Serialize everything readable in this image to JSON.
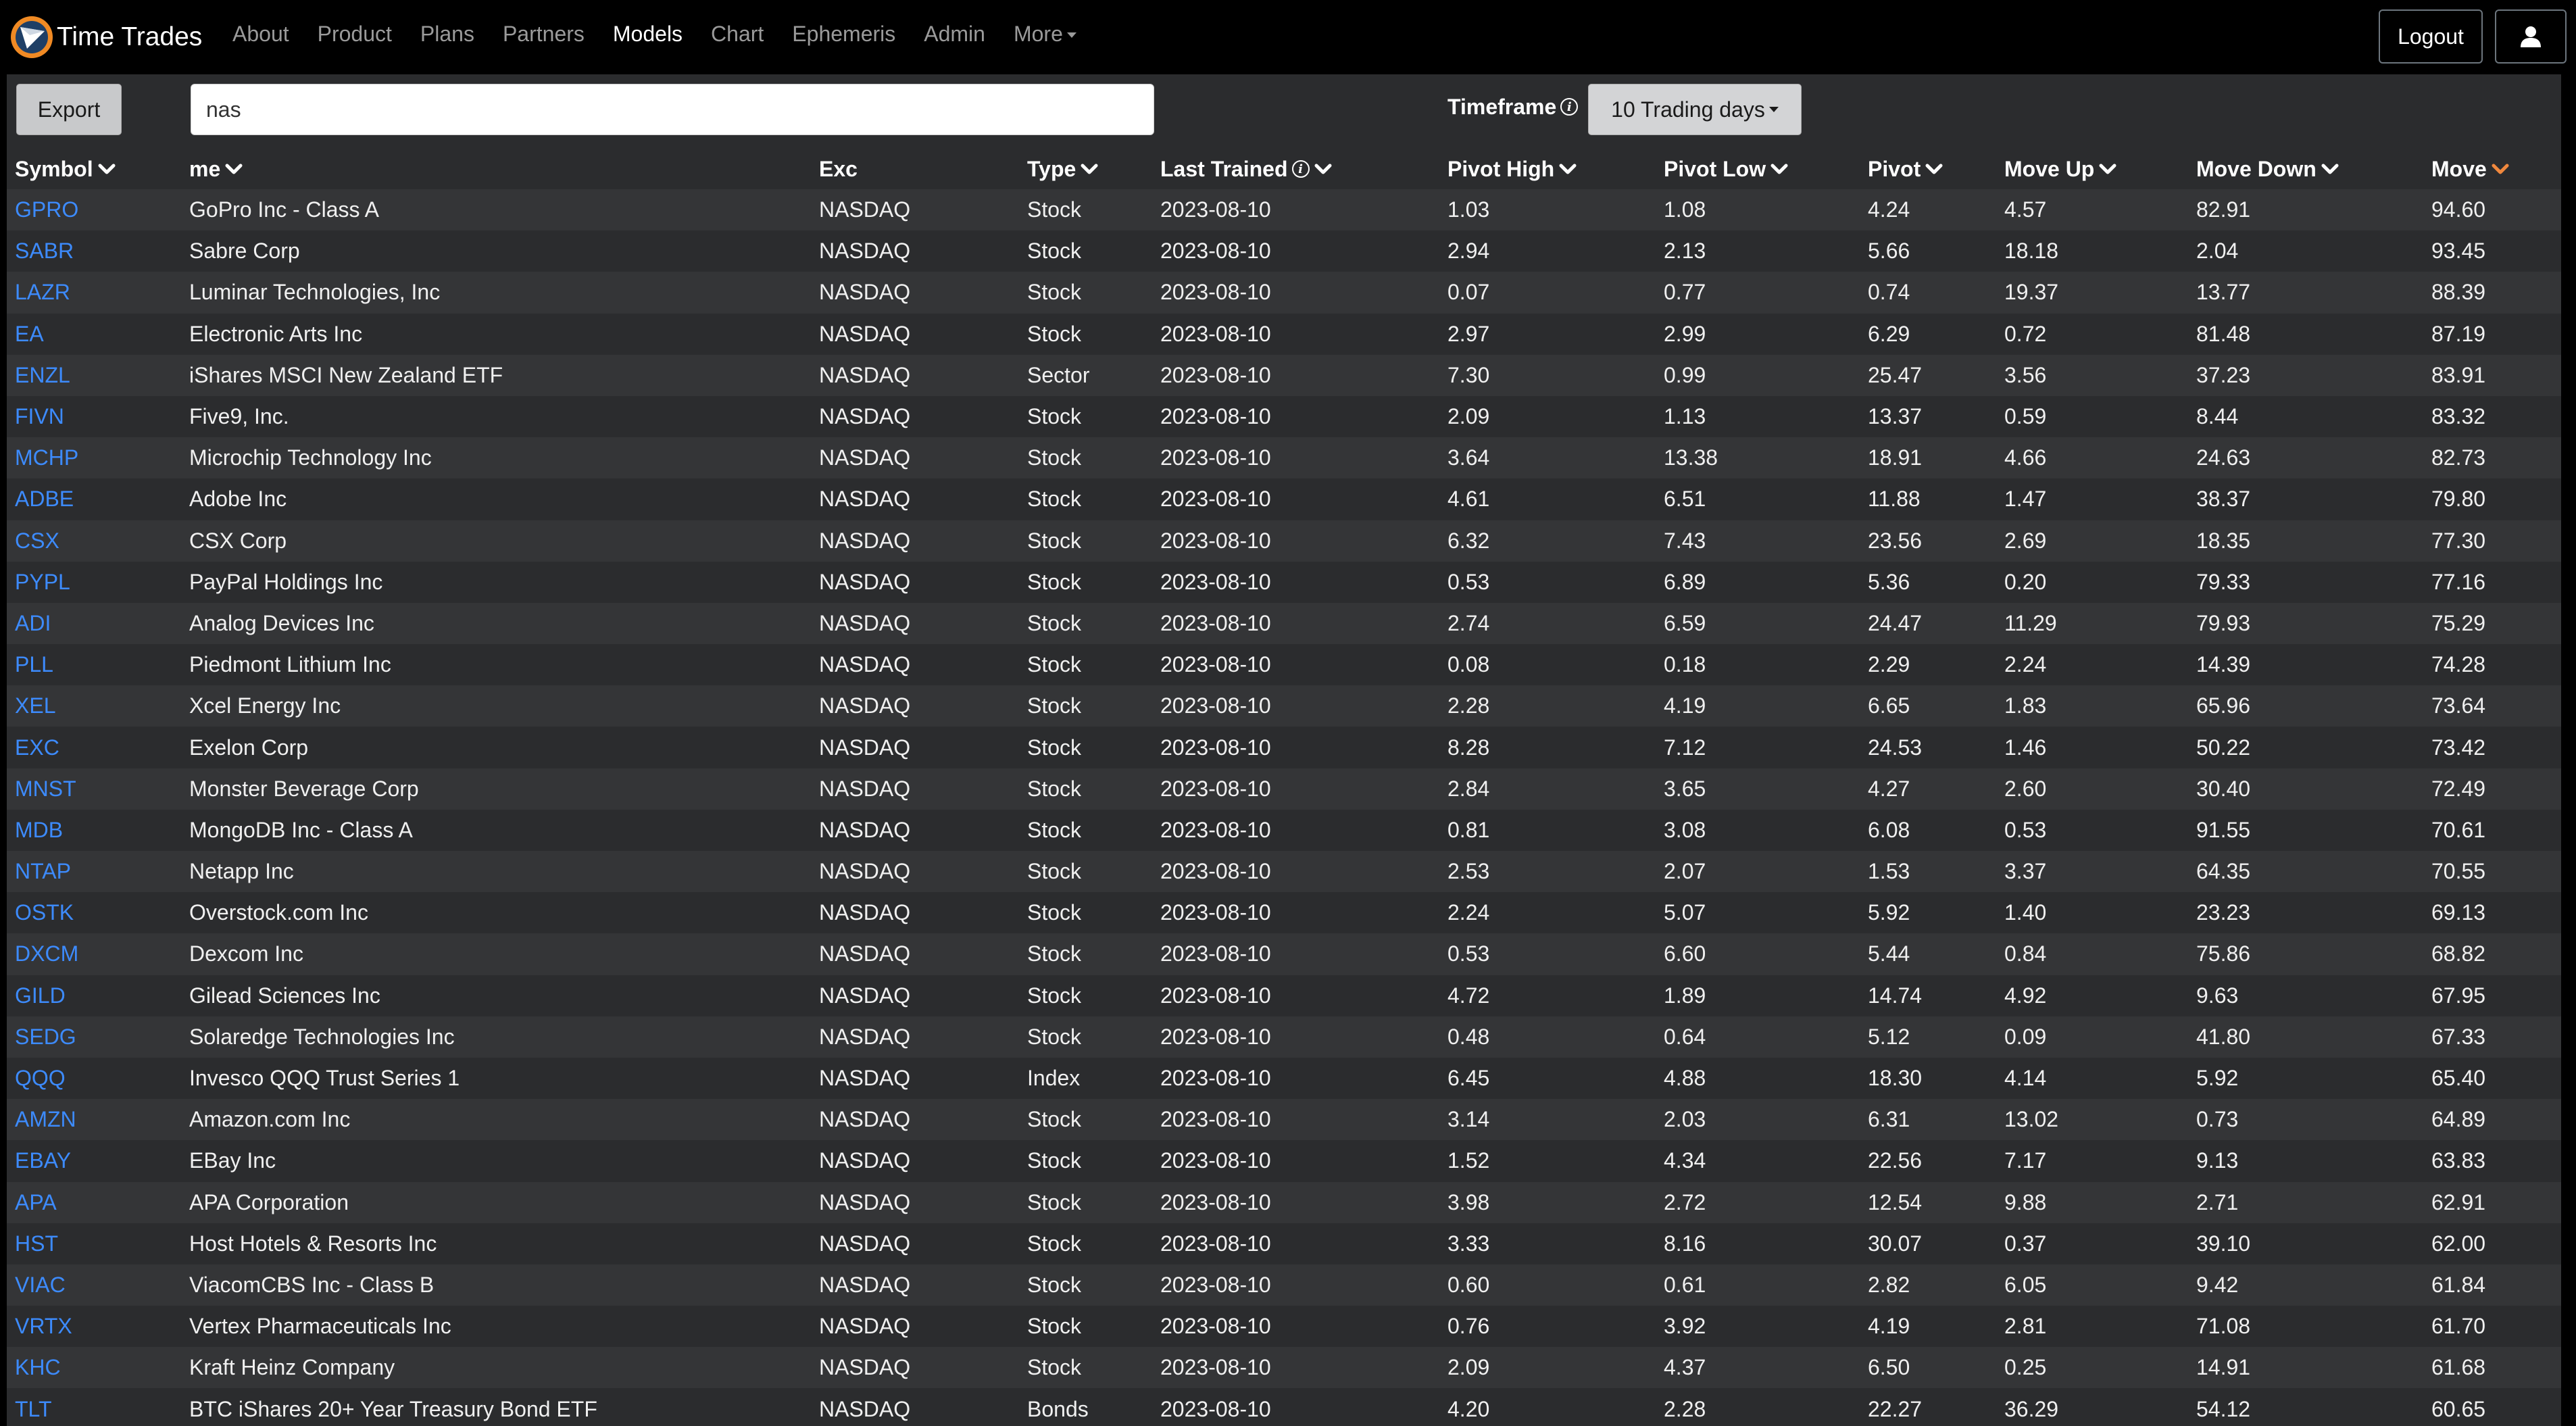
{
  "nav": {
    "brand": "Time Trades",
    "links": [
      "About",
      "Product",
      "Plans",
      "Partners",
      "Models",
      "Chart",
      "Ephemeris",
      "Admin",
      "More"
    ],
    "active": "Models",
    "logout": "Logout"
  },
  "toolbar": {
    "export_label": "Export",
    "search_value": "nas",
    "timeframe_label": "Timeframe",
    "timeframe_value": "10 Trading days"
  },
  "table": {
    "headers": [
      "Symbol",
      "me",
      "Exc",
      "Type",
      "Last Trained",
      "Pivot High",
      "Pivot Low",
      "Pivot",
      "Move Up",
      "Move Down",
      "Move"
    ],
    "sorted_header": "Move",
    "accent": "#f0883e",
    "link_color": "#3d8bfd",
    "rows": [
      [
        "GPRO",
        "GoPro Inc - Class A",
        "NASDAQ",
        "Stock",
        "2023-08-10",
        "1.03",
        "1.08",
        "4.24",
        "4.57",
        "82.91",
        "94.60"
      ],
      [
        "SABR",
        "Sabre Corp",
        "NASDAQ",
        "Stock",
        "2023-08-10",
        "2.94",
        "2.13",
        "5.66",
        "18.18",
        "2.04",
        "93.45"
      ],
      [
        "LAZR",
        "Luminar Technologies, Inc",
        "NASDAQ",
        "Stock",
        "2023-08-10",
        "0.07",
        "0.77",
        "0.74",
        "19.37",
        "13.77",
        "88.39"
      ],
      [
        "EA",
        "Electronic Arts Inc",
        "NASDAQ",
        "Stock",
        "2023-08-10",
        "2.97",
        "2.99",
        "6.29",
        "0.72",
        "81.48",
        "87.19"
      ],
      [
        "ENZL",
        "iShares MSCI New Zealand ETF",
        "NASDAQ",
        "Sector",
        "2023-08-10",
        "7.30",
        "0.99",
        "25.47",
        "3.56",
        "37.23",
        "83.91"
      ],
      [
        "FIVN",
        "Five9, Inc.",
        "NASDAQ",
        "Stock",
        "2023-08-10",
        "2.09",
        "1.13",
        "13.37",
        "0.59",
        "8.44",
        "83.32"
      ],
      [
        "MCHP",
        "Microchip Technology Inc",
        "NASDAQ",
        "Stock",
        "2023-08-10",
        "3.64",
        "13.38",
        "18.91",
        "4.66",
        "24.63",
        "82.73"
      ],
      [
        "ADBE",
        "Adobe Inc",
        "NASDAQ",
        "Stock",
        "2023-08-10",
        "4.61",
        "6.51",
        "11.88",
        "1.47",
        "38.37",
        "79.80"
      ],
      [
        "CSX",
        "CSX Corp",
        "NASDAQ",
        "Stock",
        "2023-08-10",
        "6.32",
        "7.43",
        "23.56",
        "2.69",
        "18.35",
        "77.30"
      ],
      [
        "PYPL",
        "PayPal Holdings Inc",
        "NASDAQ",
        "Stock",
        "2023-08-10",
        "0.53",
        "6.89",
        "5.36",
        "0.20",
        "79.33",
        "77.16"
      ],
      [
        "ADI",
        "Analog Devices Inc",
        "NASDAQ",
        "Stock",
        "2023-08-10",
        "2.74",
        "6.59",
        "24.47",
        "11.29",
        "79.93",
        "75.29"
      ],
      [
        "PLL",
        "Piedmont Lithium Inc",
        "NASDAQ",
        "Stock",
        "2023-08-10",
        "0.08",
        "0.18",
        "2.29",
        "2.24",
        "14.39",
        "74.28"
      ],
      [
        "XEL",
        "Xcel Energy Inc",
        "NASDAQ",
        "Stock",
        "2023-08-10",
        "2.28",
        "4.19",
        "6.65",
        "1.83",
        "65.96",
        "73.64"
      ],
      [
        "EXC",
        "Exelon Corp",
        "NASDAQ",
        "Stock",
        "2023-08-10",
        "8.28",
        "7.12",
        "24.53",
        "1.46",
        "50.22",
        "73.42"
      ],
      [
        "MNST",
        "Monster Beverage Corp",
        "NASDAQ",
        "Stock",
        "2023-08-10",
        "2.84",
        "3.65",
        "4.27",
        "2.60",
        "30.40",
        "72.49"
      ],
      [
        "MDB",
        "MongoDB Inc - Class A",
        "NASDAQ",
        "Stock",
        "2023-08-10",
        "0.81",
        "3.08",
        "6.08",
        "0.53",
        "91.55",
        "70.61"
      ],
      [
        "NTAP",
        "Netapp Inc",
        "NASDAQ",
        "Stock",
        "2023-08-10",
        "2.53",
        "2.07",
        "1.53",
        "3.37",
        "64.35",
        "70.55"
      ],
      [
        "OSTK",
        "Overstock.com Inc",
        "NASDAQ",
        "Stock",
        "2023-08-10",
        "2.24",
        "5.07",
        "5.92",
        "1.40",
        "23.23",
        "69.13"
      ],
      [
        "DXCM",
        "Dexcom Inc",
        "NASDAQ",
        "Stock",
        "2023-08-10",
        "0.53",
        "6.60",
        "5.44",
        "0.84",
        "75.86",
        "68.82"
      ],
      [
        "GILD",
        "Gilead Sciences Inc",
        "NASDAQ",
        "Stock",
        "2023-08-10",
        "4.72",
        "1.89",
        "14.74",
        "4.92",
        "9.63",
        "67.95"
      ],
      [
        "SEDG",
        "Solaredge Technologies Inc",
        "NASDAQ",
        "Stock",
        "2023-08-10",
        "0.48",
        "0.64",
        "5.12",
        "0.09",
        "41.80",
        "67.33"
      ],
      [
        "QQQ",
        "Invesco QQQ Trust Series 1",
        "NASDAQ",
        "Index",
        "2023-08-10",
        "6.45",
        "4.88",
        "18.30",
        "4.14",
        "5.92",
        "65.40"
      ],
      [
        "AMZN",
        "Amazon.com Inc",
        "NASDAQ",
        "Stock",
        "2023-08-10",
        "3.14",
        "2.03",
        "6.31",
        "13.02",
        "0.73",
        "64.89"
      ],
      [
        "EBAY",
        "EBay Inc",
        "NASDAQ",
        "Stock",
        "2023-08-10",
        "1.52",
        "4.34",
        "22.56",
        "7.17",
        "9.13",
        "63.83"
      ],
      [
        "APA",
        "APA Corporation",
        "NASDAQ",
        "Stock",
        "2023-08-10",
        "3.98",
        "2.72",
        "12.54",
        "9.88",
        "2.71",
        "62.91"
      ],
      [
        "HST",
        "Host Hotels & Resorts Inc",
        "NASDAQ",
        "Stock",
        "2023-08-10",
        "3.33",
        "8.16",
        "30.07",
        "0.37",
        "39.10",
        "62.00"
      ],
      [
        "VIAC",
        "ViacomCBS Inc - Class B",
        "NASDAQ",
        "Stock",
        "2023-08-10",
        "0.60",
        "0.61",
        "2.82",
        "6.05",
        "9.42",
        "61.84"
      ],
      [
        "VRTX",
        "Vertex Pharmaceuticals Inc",
        "NASDAQ",
        "Stock",
        "2023-08-10",
        "0.76",
        "3.92",
        "4.19",
        "2.81",
        "71.08",
        "61.70"
      ],
      [
        "KHC",
        "Kraft Heinz Company",
        "NASDAQ",
        "Stock",
        "2023-08-10",
        "2.09",
        "4.37",
        "6.50",
        "0.25",
        "14.91",
        "61.68"
      ],
      [
        "TLT",
        "BTC iShares 20+ Year Treasury Bond ETF",
        "NASDAQ",
        "Bonds",
        "2023-08-10",
        "4.20",
        "2.28",
        "22.27",
        "36.29",
        "54.12",
        "60.65"
      ]
    ]
  }
}
